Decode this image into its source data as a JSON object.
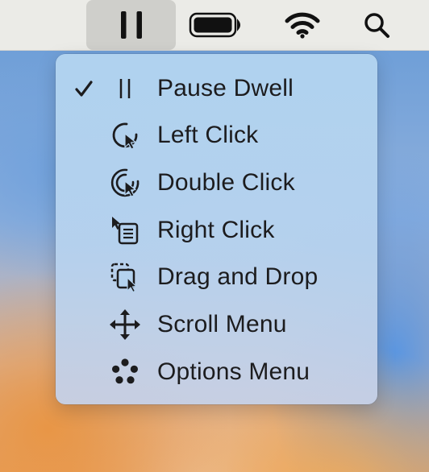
{
  "menubar": {
    "items": [
      {
        "icon": "pause-icon",
        "active": true
      },
      {
        "icon": "battery-icon"
      },
      {
        "icon": "wifi-icon"
      },
      {
        "icon": "search-icon"
      }
    ]
  },
  "dwell_menu": {
    "items": [
      {
        "label": "Pause Dwell",
        "icon": "pause-icon",
        "checked": true
      },
      {
        "label": "Left Click",
        "icon": "left-click-icon",
        "checked": false
      },
      {
        "label": "Double Click",
        "icon": "double-click-icon",
        "checked": false
      },
      {
        "label": "Right Click",
        "icon": "right-click-icon",
        "checked": false
      },
      {
        "label": "Drag and Drop",
        "icon": "drag-and-drop-icon",
        "checked": false
      },
      {
        "label": "Scroll Menu",
        "icon": "scroll-menu-icon",
        "checked": false
      },
      {
        "label": "Options Menu",
        "icon": "options-menu-icon",
        "checked": false
      }
    ]
  },
  "colors": {
    "menubar_bg": "#ebebe7",
    "menubar_active": "#cfcfcb",
    "menu_text": "#1c1c1e"
  }
}
